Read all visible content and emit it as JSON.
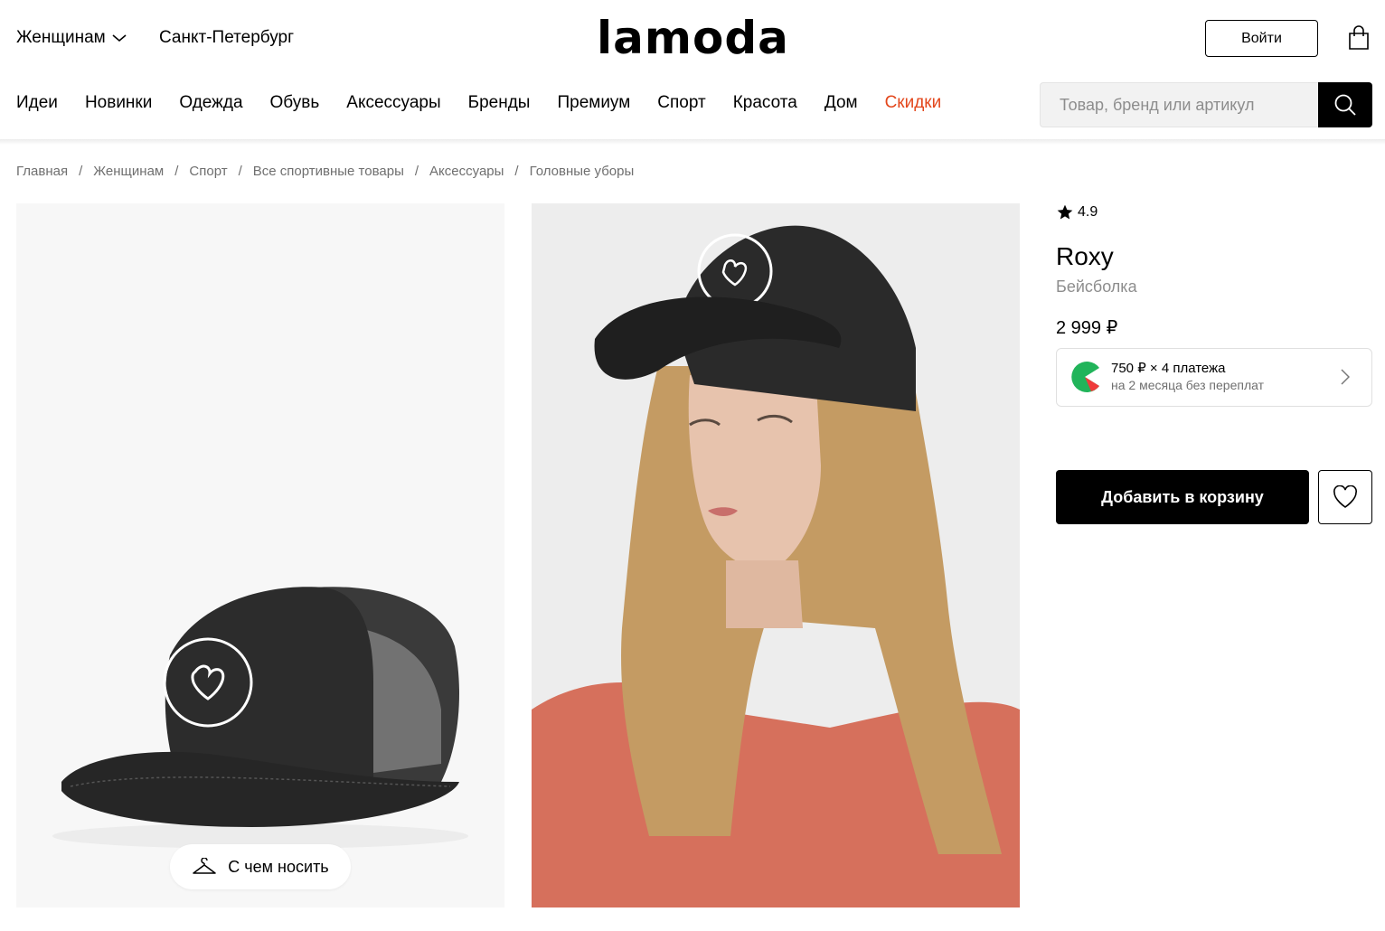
{
  "header": {
    "gender_label": "Женщинам",
    "city_label": "Санкт-Петербург",
    "logo_text": "lamoda",
    "login_label": "Войти"
  },
  "nav": {
    "items": [
      {
        "label": "Идеи"
      },
      {
        "label": "Новинки"
      },
      {
        "label": "Одежда"
      },
      {
        "label": "Обувь"
      },
      {
        "label": "Аксессуары"
      },
      {
        "label": "Бренды"
      },
      {
        "label": "Премиум"
      },
      {
        "label": "Спорт"
      },
      {
        "label": "Красота"
      },
      {
        "label": "Дом"
      },
      {
        "label": "Скидки"
      }
    ],
    "sale_color": "#e3471c"
  },
  "search": {
    "placeholder": "Товар, бренд или артикул"
  },
  "breadcrumb": {
    "items": [
      "Главная",
      "Женщинам",
      "Спорт",
      "Все спортивные товары",
      "Аксессуары",
      "Головные уборы"
    ],
    "separator": "/"
  },
  "gallery": {
    "look_button_label": "С чем носить"
  },
  "product": {
    "rating": "4.9",
    "brand": "Roxy",
    "type": "Бейсболка",
    "price": "2 999 ₽",
    "split_line1": "750 ₽ × 4 платежа",
    "split_line2": "на 2 месяца без переплат",
    "add_to_cart_label": "Добавить в корзину"
  }
}
